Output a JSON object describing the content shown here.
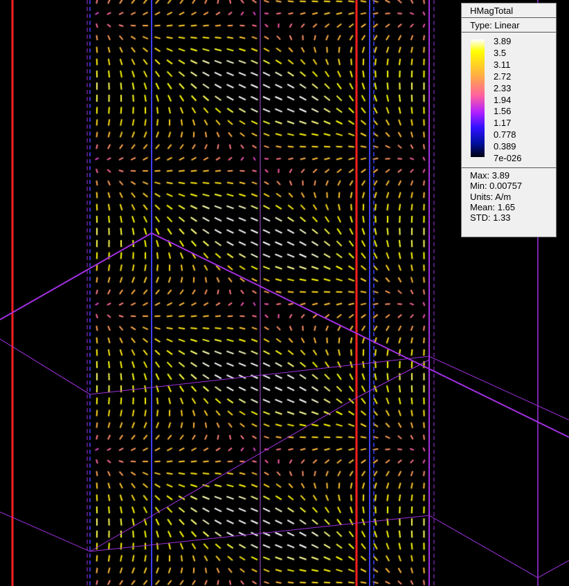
{
  "legend": {
    "quantity": "HMagTotal",
    "type": "Type: Linear",
    "scale_values": [
      "3.89",
      "3.5",
      "3.11",
      "2.72",
      "2.33",
      "1.94",
      "1.56",
      "1.17",
      "0.778",
      "0.389",
      "7e-026"
    ],
    "stats": {
      "max": "Max: 3.89",
      "min": "Min: 0.00757",
      "units": "Units: A/m",
      "mean": "Mean: 1.65",
      "std": "STD: 1.33"
    }
  },
  "colors": {
    "boundary_red": "#ff2020",
    "boundary_blue": "#4040ff",
    "boundary_purple": "#a030e0"
  },
  "field_range": [
    0.00757,
    3.89
  ]
}
